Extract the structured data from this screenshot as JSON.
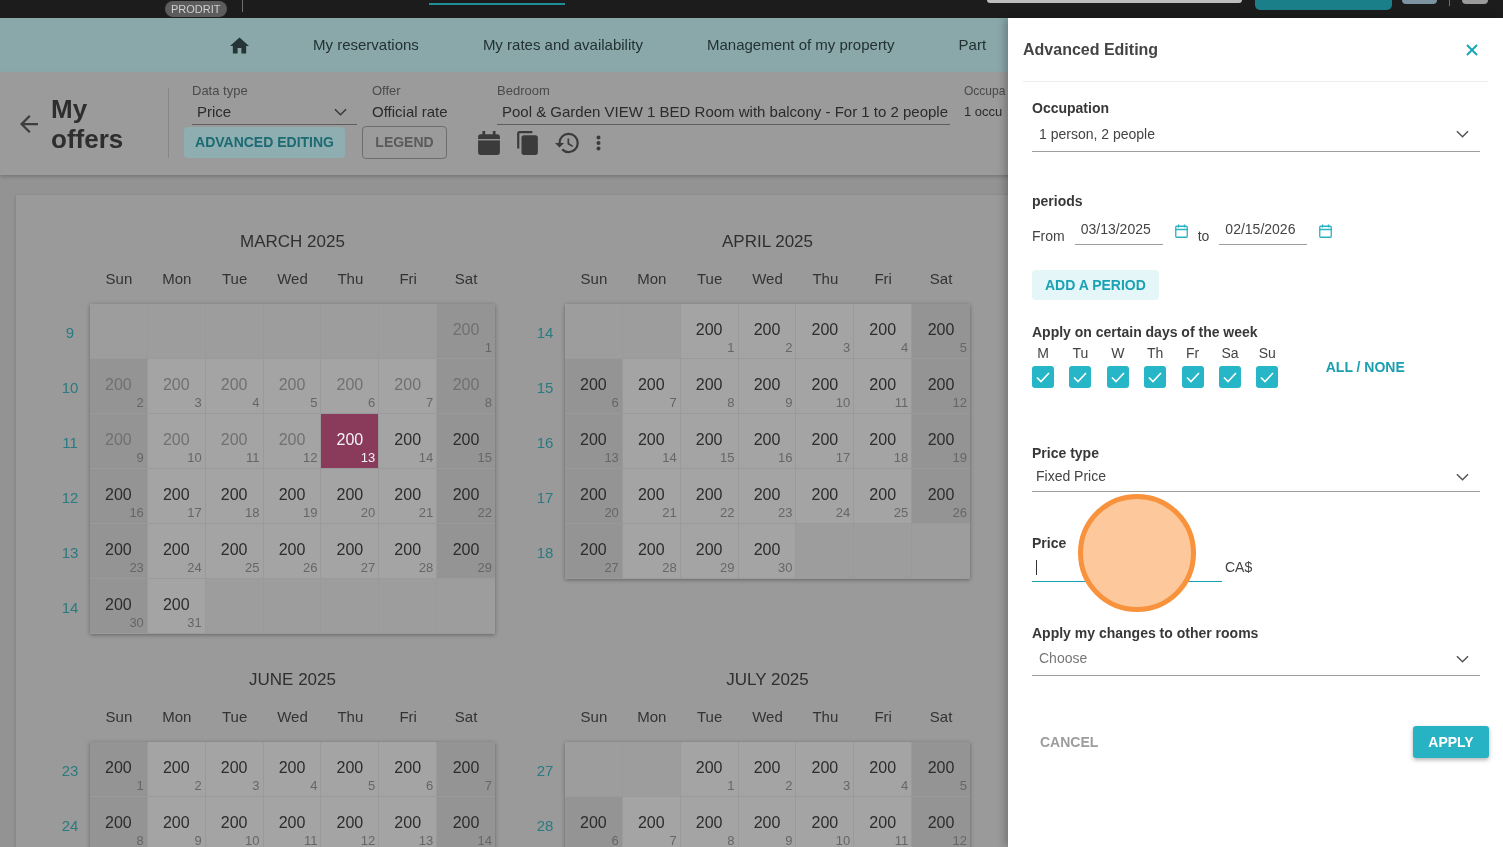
{
  "top_bar": {
    "badge": "PRODRIT"
  },
  "nav": [
    "My reservations",
    "My rates and availability",
    "Management of my property",
    "Part"
  ],
  "page_header": {
    "title": "My offers",
    "filters": [
      {
        "label": "Data type",
        "value": "Price",
        "kind": "select"
      },
      {
        "label": "Offer",
        "value": "Official rate",
        "kind": "text"
      },
      {
        "label": "Bedroom",
        "value": "Pool & Garden VIEW 1 BED Room with balcony - For 1 to 2 people",
        "kind": "select"
      },
      {
        "label": "Occupa",
        "value": "1 occu",
        "kind": "text"
      }
    ],
    "buttons": [
      {
        "label": "ADVANCED EDITING",
        "kind": "tonal"
      },
      {
        "label": "LEGEND",
        "kind": "outlined"
      }
    ]
  },
  "calendar": {
    "months": [
      {
        "title": "MARCH 2025",
        "weekdays": [
          "Sun",
          "Mon",
          "Tue",
          "Wed",
          "Thu",
          "Fri",
          "Sat"
        ],
        "weeks": [
          {
            "number": "9",
            "days": [
              {
                "kind": "empty"
              },
              {
                "kind": "empty"
              },
              {
                "kind": "empty"
              },
              {
                "kind": "empty"
              },
              {
                "kind": "empty"
              },
              {
                "kind": "empty"
              },
              {
                "kind": "day",
                "date": "1",
                "price": "200",
                "past": true,
                "selected": false
              }
            ]
          },
          {
            "number": "10",
            "days": [
              {
                "kind": "day",
                "date": "2",
                "price": "200",
                "past": true,
                "selected": false
              },
              {
                "kind": "day",
                "date": "3",
                "price": "200",
                "past": true,
                "selected": false
              },
              {
                "kind": "day",
                "date": "4",
                "price": "200",
                "past": true,
                "selected": false
              },
              {
                "kind": "day",
                "date": "5",
                "price": "200",
                "past": true,
                "selected": false
              },
              {
                "kind": "day",
                "date": "6",
                "price": "200",
                "past": true,
                "selected": false
              },
              {
                "kind": "day",
                "date": "7",
                "price": "200",
                "past": true,
                "selected": false
              },
              {
                "kind": "day",
                "date": "8",
                "price": "200",
                "past": true,
                "selected": false
              }
            ]
          },
          {
            "number": "11",
            "days": [
              {
                "kind": "day",
                "date": "9",
                "price": "200",
                "past": true,
                "selected": false
              },
              {
                "kind": "day",
                "date": "10",
                "price": "200",
                "past": true,
                "selected": false
              },
              {
                "kind": "day",
                "date": "11",
                "price": "200",
                "past": true,
                "selected": false
              },
              {
                "kind": "day",
                "date": "12",
                "price": "200",
                "past": true,
                "selected": false
              },
              {
                "kind": "day",
                "date": "13",
                "price": "200",
                "past": false,
                "selected": true
              },
              {
                "kind": "day",
                "date": "14",
                "price": "200",
                "past": false,
                "selected": false
              },
              {
                "kind": "day",
                "date": "15",
                "price": "200",
                "past": false,
                "selected": false
              }
            ]
          },
          {
            "number": "12",
            "days": [
              {
                "kind": "day",
                "date": "16",
                "price": "200",
                "past": false,
                "selected": false
              },
              {
                "kind": "day",
                "date": "17",
                "price": "200",
                "past": false,
                "selected": false
              },
              {
                "kind": "day",
                "date": "18",
                "price": "200",
                "past": false,
                "selected": false
              },
              {
                "kind": "day",
                "date": "19",
                "price": "200",
                "past": false,
                "selected": false
              },
              {
                "kind": "day",
                "date": "20",
                "price": "200",
                "past": false,
                "selected": false
              },
              {
                "kind": "day",
                "date": "21",
                "price": "200",
                "past": false,
                "selected": false
              },
              {
                "kind": "day",
                "date": "22",
                "price": "200",
                "past": false,
                "selected": false
              }
            ]
          },
          {
            "number": "13",
            "days": [
              {
                "kind": "day",
                "date": "23",
                "price": "200",
                "past": false,
                "selected": false
              },
              {
                "kind": "day",
                "date": "24",
                "price": "200",
                "past": false,
                "selected": false
              },
              {
                "kind": "day",
                "date": "25",
                "price": "200",
                "past": false,
                "selected": false
              },
              {
                "kind": "day",
                "date": "26",
                "price": "200",
                "past": false,
                "selected": false
              },
              {
                "kind": "day",
                "date": "27",
                "price": "200",
                "past": false,
                "selected": false
              },
              {
                "kind": "day",
                "date": "28",
                "price": "200",
                "past": false,
                "selected": false
              },
              {
                "kind": "day",
                "date": "29",
                "price": "200",
                "past": false,
                "selected": false
              }
            ]
          },
          {
            "number": "14",
            "days": [
              {
                "kind": "day",
                "date": "30",
                "price": "200",
                "past": false,
                "selected": false
              },
              {
                "kind": "day",
                "date": "31",
                "price": "200",
                "past": false,
                "selected": false
              },
              {
                "kind": "empty"
              },
              {
                "kind": "empty"
              },
              {
                "kind": "empty"
              },
              {
                "kind": "empty"
              },
              {
                "kind": "empty"
              }
            ]
          }
        ]
      },
      {
        "title": "APRIL 2025",
        "weekdays": [
          "Sun",
          "Mon",
          "Tue",
          "Wed",
          "Thu",
          "Fri",
          "Sat"
        ],
        "weeks": [
          {
            "number": "14",
            "days": [
              {
                "kind": "empty"
              },
              {
                "kind": "empty"
              },
              {
                "kind": "day",
                "date": "1",
                "price": "200",
                "past": false,
                "selected": false
              },
              {
                "kind": "day",
                "date": "2",
                "price": "200",
                "past": false,
                "selected": false
              },
              {
                "kind": "day",
                "date": "3",
                "price": "200",
                "past": false,
                "selected": false
              },
              {
                "kind": "day",
                "date": "4",
                "price": "200",
                "past": false,
                "selected": false
              },
              {
                "kind": "day",
                "date": "5",
                "price": "200",
                "past": false,
                "selected": false
              }
            ]
          },
          {
            "number": "15",
            "days": [
              {
                "kind": "day",
                "date": "6",
                "price": "200",
                "past": false,
                "selected": false
              },
              {
                "kind": "day",
                "date": "7",
                "price": "200",
                "past": false,
                "selected": false
              },
              {
                "kind": "day",
                "date": "8",
                "price": "200",
                "past": false,
                "selected": false
              },
              {
                "kind": "day",
                "date": "9",
                "price": "200",
                "past": false,
                "selected": false
              },
              {
                "kind": "day",
                "date": "10",
                "price": "200",
                "past": false,
                "selected": false
              },
              {
                "kind": "day",
                "date": "11",
                "price": "200",
                "past": false,
                "selected": false
              },
              {
                "kind": "day",
                "date": "12",
                "price": "200",
                "past": false,
                "selected": false
              }
            ]
          },
          {
            "number": "16",
            "days": [
              {
                "kind": "day",
                "date": "13",
                "price": "200",
                "past": false,
                "selected": false
              },
              {
                "kind": "day",
                "date": "14",
                "price": "200",
                "past": false,
                "selected": false
              },
              {
                "kind": "day",
                "date": "15",
                "price": "200",
                "past": false,
                "selected": false
              },
              {
                "kind": "day",
                "date": "16",
                "price": "200",
                "past": false,
                "selected": false
              },
              {
                "kind": "day",
                "date": "17",
                "price": "200",
                "past": false,
                "selected": false
              },
              {
                "kind": "day",
                "date": "18",
                "price": "200",
                "past": false,
                "selected": false
              },
              {
                "kind": "day",
                "date": "19",
                "price": "200",
                "past": false,
                "selected": false
              }
            ]
          },
          {
            "number": "17",
            "days": [
              {
                "kind": "day",
                "date": "20",
                "price": "200",
                "past": false,
                "selected": false
              },
              {
                "kind": "day",
                "date": "21",
                "price": "200",
                "past": false,
                "selected": false
              },
              {
                "kind": "day",
                "date": "22",
                "price": "200",
                "past": false,
                "selected": false
              },
              {
                "kind": "day",
                "date": "23",
                "price": "200",
                "past": false,
                "selected": false
              },
              {
                "kind": "day",
                "date": "24",
                "price": "200",
                "past": false,
                "selected": false
              },
              {
                "kind": "day",
                "date": "25",
                "price": "200",
                "past": false,
                "selected": false
              },
              {
                "kind": "day",
                "date": "26",
                "price": "200",
                "past": false,
                "selected": false
              }
            ]
          },
          {
            "number": "18",
            "days": [
              {
                "kind": "day",
                "date": "27",
                "price": "200",
                "past": false,
                "selected": false
              },
              {
                "kind": "day",
                "date": "28",
                "price": "200",
                "past": false,
                "selected": false
              },
              {
                "kind": "day",
                "date": "29",
                "price": "200",
                "past": false,
                "selected": false
              },
              {
                "kind": "day",
                "date": "30",
                "price": "200",
                "past": false,
                "selected": false
              },
              {
                "kind": "empty"
              },
              {
                "kind": "empty"
              },
              {
                "kind": "empty"
              }
            ]
          }
        ]
      },
      {
        "title": "JUNE 2025",
        "weekdays": [
          "Sun",
          "Mon",
          "Tue",
          "Wed",
          "Thu",
          "Fri",
          "Sat"
        ],
        "weeks": [
          {
            "number": "23",
            "days": [
              {
                "kind": "day",
                "date": "1",
                "price": "200",
                "past": false,
                "selected": false
              },
              {
                "kind": "day",
                "date": "2",
                "price": "200",
                "past": false,
                "selected": false
              },
              {
                "kind": "day",
                "date": "3",
                "price": "200",
                "past": false,
                "selected": false
              },
              {
                "kind": "day",
                "date": "4",
                "price": "200",
                "past": false,
                "selected": false
              },
              {
                "kind": "day",
                "date": "5",
                "price": "200",
                "past": false,
                "selected": false
              },
              {
                "kind": "day",
                "date": "6",
                "price": "200",
                "past": false,
                "selected": false
              },
              {
                "kind": "day",
                "date": "7",
                "price": "200",
                "past": false,
                "selected": false
              }
            ]
          },
          {
            "number": "24",
            "days": [
              {
                "kind": "day",
                "date": "8",
                "price": "200",
                "past": false,
                "selected": false
              },
              {
                "kind": "day",
                "date": "9",
                "price": "200",
                "past": false,
                "selected": false
              },
              {
                "kind": "day",
                "date": "10",
                "price": "200",
                "past": false,
                "selected": false
              },
              {
                "kind": "day",
                "date": "11",
                "price": "200",
                "past": false,
                "selected": false
              },
              {
                "kind": "day",
                "date": "12",
                "price": "200",
                "past": false,
                "selected": false
              },
              {
                "kind": "day",
                "date": "13",
                "price": "200",
                "past": false,
                "selected": false
              },
              {
                "kind": "day",
                "date": "14",
                "price": "200",
                "past": false,
                "selected": false
              }
            ]
          }
        ]
      },
      {
        "title": "JULY 2025",
        "weekdays": [
          "Sun",
          "Mon",
          "Tue",
          "Wed",
          "Thu",
          "Fri",
          "Sat"
        ],
        "weeks": [
          {
            "number": "27",
            "days": [
              {
                "kind": "empty"
              },
              {
                "kind": "empty"
              },
              {
                "kind": "day",
                "date": "1",
                "price": "200",
                "past": false,
                "selected": false
              },
              {
                "kind": "day",
                "date": "2",
                "price": "200",
                "past": false,
                "selected": false
              },
              {
                "kind": "day",
                "date": "3",
                "price": "200",
                "past": false,
                "selected": false
              },
              {
                "kind": "day",
                "date": "4",
                "price": "200",
                "past": false,
                "selected": false
              },
              {
                "kind": "day",
                "date": "5",
                "price": "200",
                "past": false,
                "selected": false
              }
            ]
          },
          {
            "number": "28",
            "days": [
              {
                "kind": "day",
                "date": "6",
                "price": "200",
                "past": false,
                "selected": false
              },
              {
                "kind": "day",
                "date": "7",
                "price": "200",
                "past": false,
                "selected": false
              },
              {
                "kind": "day",
                "date": "8",
                "price": "200",
                "past": false,
                "selected": false
              },
              {
                "kind": "day",
                "date": "9",
                "price": "200",
                "past": false,
                "selected": false
              },
              {
                "kind": "day",
                "date": "10",
                "price": "200",
                "past": false,
                "selected": false
              },
              {
                "kind": "day",
                "date": "11",
                "price": "200",
                "past": false,
                "selected": false
              },
              {
                "kind": "day",
                "date": "12",
                "price": "200",
                "past": false,
                "selected": false
              }
            ]
          }
        ]
      }
    ]
  },
  "advanced_editing": {
    "title": "Advanced Editing",
    "occupation": {
      "label": "Occupation",
      "value": "1 person, 2 people"
    },
    "periods": {
      "label": "periods",
      "from_label": "From",
      "from": "03/13/2025",
      "to_label": "to",
      "to": "02/15/2026",
      "add_button": "ADD A PERIOD"
    },
    "weekdays": {
      "label": "Apply on certain days of the week",
      "days": [
        {
          "label": "M",
          "checked": true
        },
        {
          "label": "Tu",
          "checked": true
        },
        {
          "label": "W",
          "checked": true
        },
        {
          "label": "Th",
          "checked": true
        },
        {
          "label": "Fr",
          "checked": true
        },
        {
          "label": "Sa",
          "checked": true
        },
        {
          "label": "Su",
          "checked": true
        }
      ],
      "toggle_all": "ALL / NONE"
    },
    "price_type": {
      "label": "Price type",
      "value": "Fixed Price"
    },
    "price": {
      "label": "Price",
      "currency": "CA$",
      "focused": true
    },
    "other_rooms": {
      "label": "Apply my changes to other rooms",
      "placeholder": "Choose"
    },
    "buttons": [
      {
        "label": "CANCEL",
        "kind": "text"
      },
      {
        "label": "APPLY",
        "kind": "primary"
      }
    ]
  }
}
